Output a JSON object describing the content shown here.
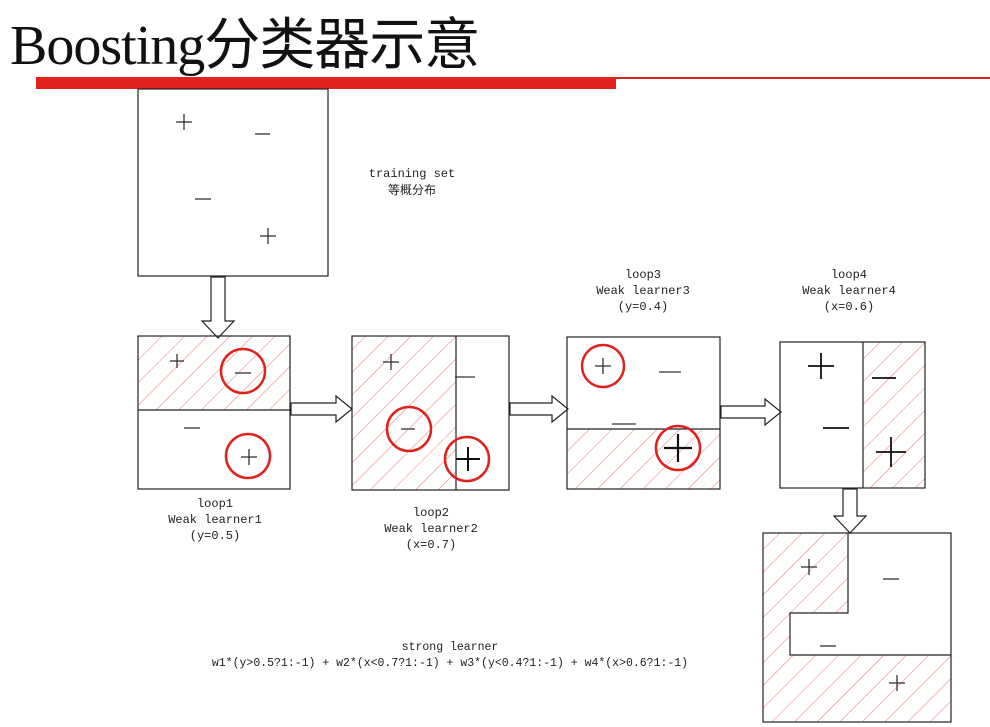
{
  "title": "Boosting分类器示意",
  "colors": {
    "accent": "#e0211d",
    "hatch": "#e8786e",
    "ink": "#222222"
  },
  "training_set": {
    "line1": "training set",
    "line2": "等概分布"
  },
  "loop1": {
    "line1": "loop1",
    "line2": "Weak learner1",
    "line3": "(y=0.5)"
  },
  "loop2": {
    "line1": "loop2",
    "line2": "Weak learner2",
    "line3": "(x=0.7)"
  },
  "loop3": {
    "line1": "loop3",
    "line2": "Weak learner3",
    "line3": "(y=0.4)"
  },
  "loop4": {
    "line1": "loop4",
    "line2": "Weak learner4",
    "line3": "(x=0.6)"
  },
  "strong": {
    "line1": "strong learner",
    "formula": "w1*(y>0.5?1:-1) + w2*(x<0.7?1:-1) + w3*(y<0.4?1:-1) + w4*(x>0.6?1:-1)"
  }
}
